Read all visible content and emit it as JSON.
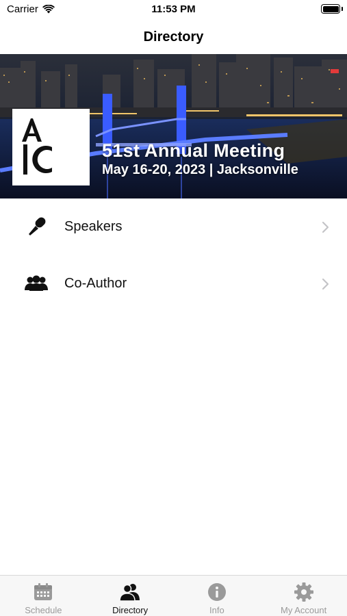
{
  "status_bar": {
    "carrier": "Carrier",
    "time": "11:53 PM",
    "battery_level": 1.0
  },
  "nav": {
    "title": "Directory"
  },
  "banner": {
    "title": "51st Annual Meeting",
    "subtitle": "May 16-20, 2023 | Jacksonville",
    "logo_text": "AIC",
    "bridge_color": "#3a5cff"
  },
  "list": [
    {
      "label": "Speakers",
      "icon": "microphone-icon"
    },
    {
      "label": "Co-Author",
      "icon": "people-group-icon"
    }
  ],
  "tabs": [
    {
      "label": "Schedule",
      "icon": "calendar-icon",
      "active": false
    },
    {
      "label": "Directory",
      "icon": "people-icon",
      "active": true
    },
    {
      "label": "Info",
      "icon": "info-icon",
      "active": false
    },
    {
      "label": "My Account",
      "icon": "gear-icon",
      "active": false
    }
  ],
  "colors": {
    "tab_active": "#111111",
    "tab_inactive": "#9a9a9a",
    "chevron": "#c4c4c7"
  }
}
